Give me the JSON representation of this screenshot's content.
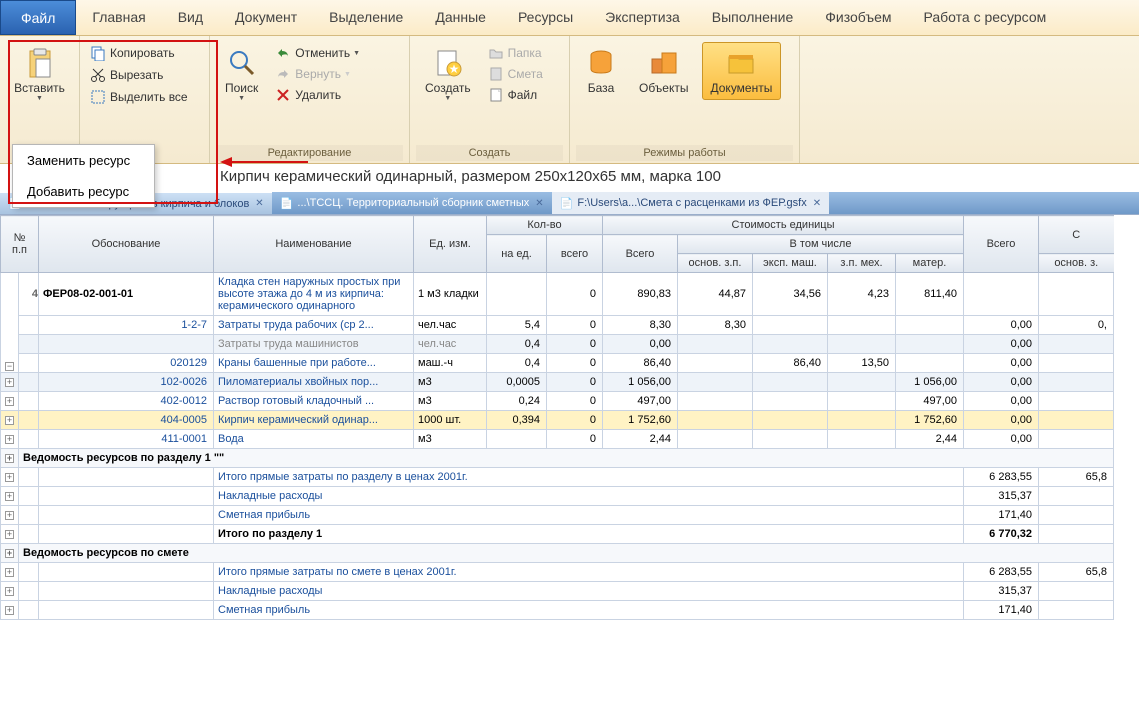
{
  "menu": {
    "file": "Файл",
    "items": [
      "Главная",
      "Вид",
      "Документ",
      "Выделение",
      "Данные",
      "Ресурсы",
      "Экспертиза",
      "Выполнение",
      "Физобъем",
      "Работа с ресурсом"
    ]
  },
  "ribbon": {
    "paste": "Вставить",
    "copy": "Копировать",
    "cut": "Вырезать",
    "select_all": "Выделить все",
    "search": "Поиск",
    "undo": "Отменить",
    "redo": "Вернуть",
    "delete": "Удалить",
    "edit_group": "Редактирование",
    "create": "Создать",
    "folder": "Папка",
    "estimate": "Смета",
    "file_item": "Файл",
    "create_group": "Создать",
    "base": "База",
    "objects": "Объекты",
    "documents": "Документы",
    "modes_group": "Режимы работы"
  },
  "paste_menu": {
    "replace": "Заменить ресурс",
    "add": "Добавить ресурс"
  },
  "title": "Кирпич керамический одинарный, размером 250х120х65 мм, марка 100",
  "tabs": [
    {
      "label": "...\\ФЕР08. Конструкции из кирпича и блоков",
      "active": true
    },
    {
      "label": "...\\ТССЦ. Территориальный сборник сметных",
      "active": false
    },
    {
      "label": "F:\\Users\\a...\\Смета с расценками из ФЕР.gsfx",
      "active": false
    }
  ],
  "headers": {
    "no": "№",
    "pp": "п.п",
    "basis": "Обоснование",
    "name": "Наименование",
    "unit": "Ед. изм.",
    "qty": "Кол-во",
    "qty_unit": "на ед.",
    "qty_total": "всего",
    "cost_unit": "Стоимость единицы",
    "total": "Всего",
    "incl": "В том числе",
    "total2": "Всего",
    "osnov": "основ. з.п.",
    "eksp": "эксп. маш.",
    "mex": "з.п. мех.",
    "mater": "матер.",
    "osnov2": "основ. з."
  },
  "rows": [
    {
      "type": "main",
      "no": "4",
      "code": "ФЕР08-02-001-01",
      "name": "Кладка стен наружных простых при высоте этажа до 4 м из кирпича: керамического одинарного",
      "unit": "1 м3 кладки",
      "qu": "",
      "qt": "0",
      "total": "890,83",
      "oz": "44,87",
      "em": "34,56",
      "zm": "4,23",
      "mt": "811,40",
      "t2": "",
      "o2": ""
    },
    {
      "type": "sub",
      "code": "1-2-7",
      "name": "Затраты труда рабочих (ср 2...",
      "unit": "чел.час",
      "qu": "5,4",
      "qt": "0",
      "total": "8,30",
      "oz": "8,30",
      "em": "",
      "zm": "",
      "mt": "",
      "t2": "0,00",
      "o2": "0,"
    },
    {
      "type": "sub",
      "code": "",
      "name": "Затраты труда машинистов",
      "unit": "чел.час",
      "qu": "0,4",
      "qt": "0",
      "total": "0,00",
      "oz": "",
      "em": "",
      "zm": "",
      "mt": "",
      "t2": "0,00",
      "o2": "",
      "gray": true
    },
    {
      "type": "sub",
      "code": "020129",
      "name": "Краны башенные при работе...",
      "unit": "маш.-ч",
      "qu": "0,4",
      "qt": "0",
      "total": "86,40",
      "oz": "",
      "em": "86,40",
      "zm": "13,50",
      "mt": "",
      "t2": "0,00",
      "o2": ""
    },
    {
      "type": "sub",
      "code": "102-0026",
      "name": "Пиломатериалы хвойных пор...",
      "unit": "м3",
      "qu": "0,0005",
      "qt": "0",
      "total": "1 056,00",
      "oz": "",
      "em": "",
      "zm": "",
      "mt": "1 056,00",
      "t2": "0,00",
      "o2": ""
    },
    {
      "type": "sub",
      "code": "402-0012",
      "name": "Раствор готовый кладочный ...",
      "unit": "м3",
      "qu": "0,24",
      "qt": "0",
      "total": "497,00",
      "oz": "",
      "em": "",
      "zm": "",
      "mt": "497,00",
      "t2": "0,00",
      "o2": ""
    },
    {
      "type": "sub",
      "code": "404-0005",
      "name": "Кирпич керамический одинар...",
      "unit": "1000 шт.",
      "qu": "0,394",
      "qt": "0",
      "total": "1 752,60",
      "oz": "",
      "em": "",
      "zm": "",
      "mt": "1 752,60",
      "t2": "0,00",
      "o2": "",
      "hl": true
    },
    {
      "type": "sub",
      "code": "411-0001",
      "name": "Вода",
      "unit": "м3",
      "qu": "",
      "qt": "0",
      "total": "2,44",
      "oz": "",
      "em": "",
      "zm": "",
      "mt": "2,44",
      "t2": "0,00",
      "o2": ""
    }
  ],
  "section1": "Ведомость ресурсов по разделу 1 \"\"",
  "summary1": [
    {
      "name": "Итого прямые затраты по разделу в ценах 2001г.",
      "t2": "6 283,55",
      "o2": "65,8"
    },
    {
      "name": "Накладные расходы",
      "t2": "315,37",
      "o2": ""
    },
    {
      "name": "Сметная прибыль",
      "t2": "171,40",
      "o2": ""
    },
    {
      "name": "Итого по разделу 1",
      "t2": "6 770,32",
      "o2": "",
      "bold": true
    }
  ],
  "section2": "Ведомость ресурсов по смете",
  "summary2": [
    {
      "name": "Итого прямые затраты по смете в ценах 2001г.",
      "t2": "6 283,55",
      "o2": "65,8"
    },
    {
      "name": "Накладные расходы",
      "t2": "315,37",
      "o2": ""
    },
    {
      "name": "Сметная прибыль",
      "t2": "171,40",
      "o2": ""
    }
  ]
}
